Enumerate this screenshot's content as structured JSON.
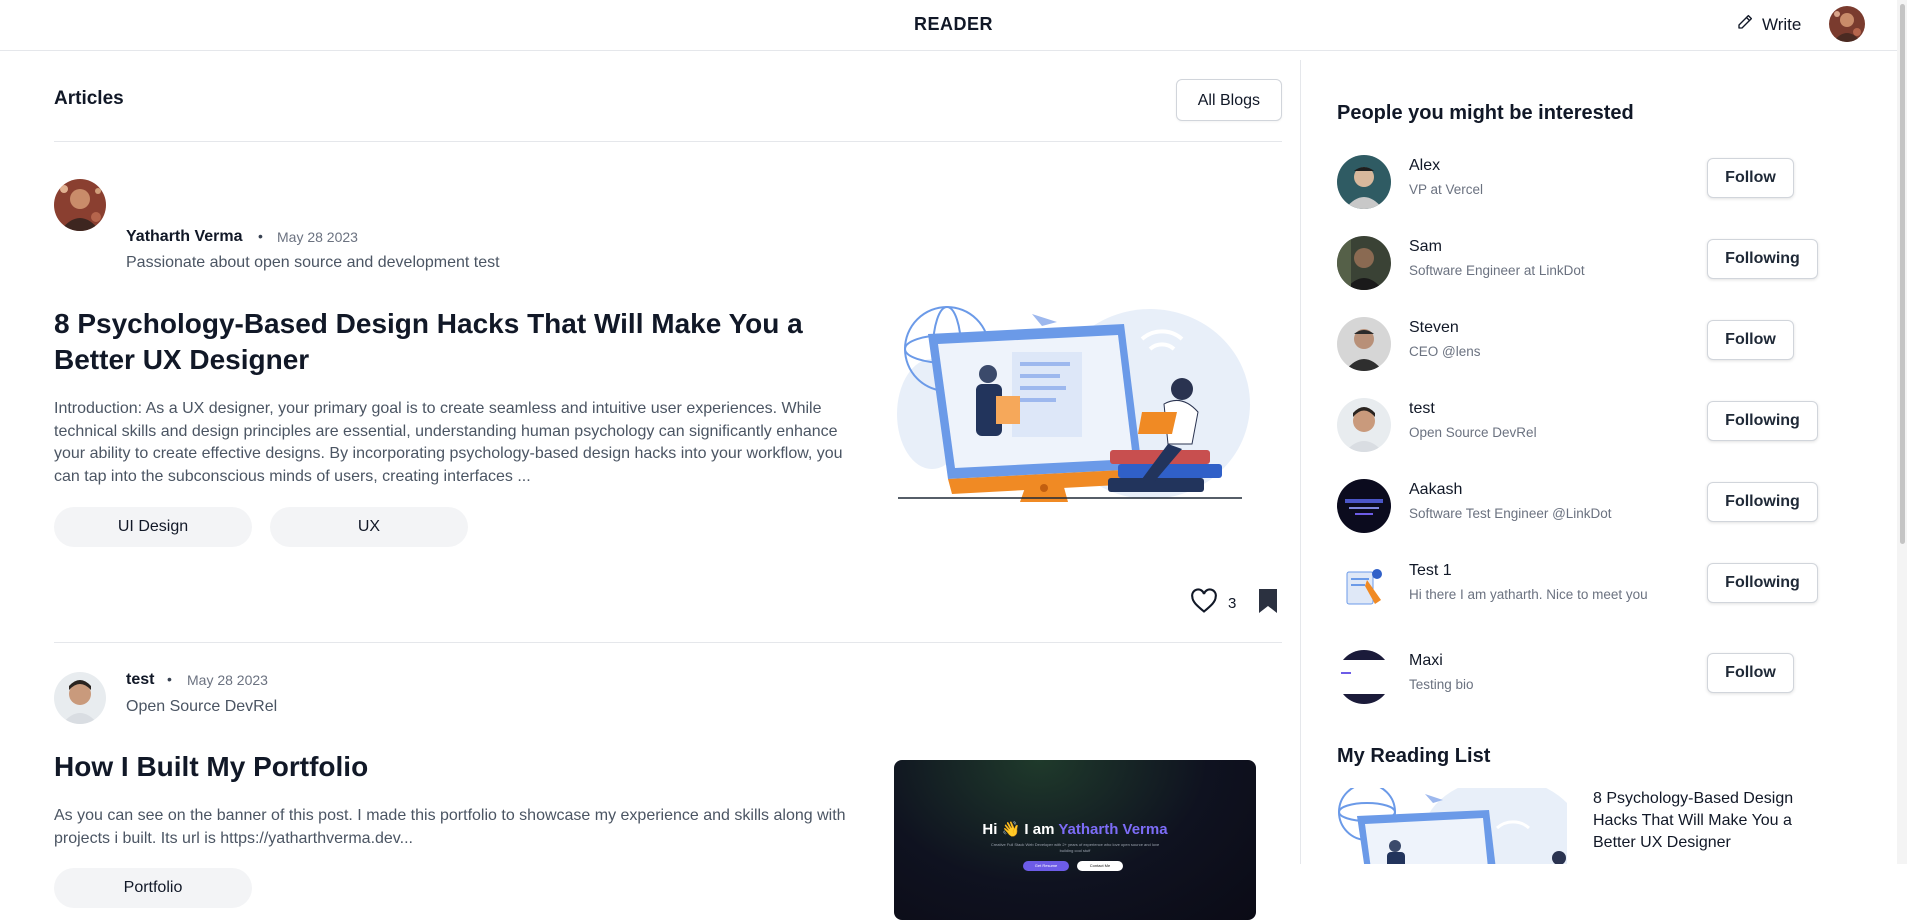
{
  "header": {
    "brand": "READER",
    "write_label": "Write"
  },
  "main": {
    "section_title": "Articles",
    "all_blogs_label": "All Blogs",
    "articles": [
      {
        "author": "Yatharth Verma",
        "date": "May 28 2023",
        "bio": "Passionate about open source and development test",
        "title": "8 Psychology-Based Design Hacks That Will Make You a Better UX Designer",
        "excerpt": "Introduction: As a UX designer, your primary goal is to create seamless and intuitive user experiences. While technical skills and design principles are essential, understanding human psychology can significantly enhance your ability to create effective designs. By incorporating psychology-based design hacks into your workflow, you can tap into the subconscious minds of users, creating interfaces ...",
        "tags": [
          "UI Design",
          "UX"
        ],
        "likes": "3"
      },
      {
        "author": "test",
        "date": "May 28 2023",
        "bio": "Open Source DevRel",
        "title": "How I Built My Portfolio",
        "excerpt": "As you can see on the banner of this post. I made this portfolio to showcase my experience and skills along with projects i built. Its url is https://yatharthverma.dev...",
        "tags": [
          "Portfolio"
        ],
        "cover": {
          "greeting": "Hi 👋 I am ",
          "name": "Yatharth Verma",
          "subtitle": "Creative Full Stack Web Developer with 2+ years of experience who love open source and love building cool stuff",
          "button_primary": "Get Resume",
          "button_secondary": "Contact Me"
        }
      }
    ]
  },
  "sidebar": {
    "title": "People you might be interested",
    "people": [
      {
        "name": "Alex",
        "bio": "VP at Vercel",
        "button": "Follow"
      },
      {
        "name": "Sam",
        "bio": "Software Engineer at LinkDot",
        "button": "Following"
      },
      {
        "name": "Steven",
        "bio": "CEO @lens",
        "button": "Follow"
      },
      {
        "name": "test",
        "bio": "Open Source DevRel",
        "button": "Following"
      },
      {
        "name": "Aakash",
        "bio": "Software Test Engineer @LinkDot",
        "button": "Following"
      },
      {
        "name": "Test 1",
        "bio": "Hi there I am yatharth. Nice to meet you",
        "button": "Following"
      },
      {
        "name": "Maxi",
        "bio": "Testing bio",
        "button": "Follow"
      }
    ],
    "reading_list_title": "My Reading List",
    "reading_list": [
      {
        "title": "8 Psychology-Based Design Hacks That Will Make You a Better UX Designer"
      }
    ]
  },
  "colors": {
    "text": "#111827",
    "muted": "#6b7280",
    "divider": "#e5e7eb",
    "tag_bg": "#f3f4f6",
    "illustration_blue": "#6b9ae8",
    "illustration_orange": "#f08a24",
    "highlight_purple": "#7c6cf6"
  }
}
